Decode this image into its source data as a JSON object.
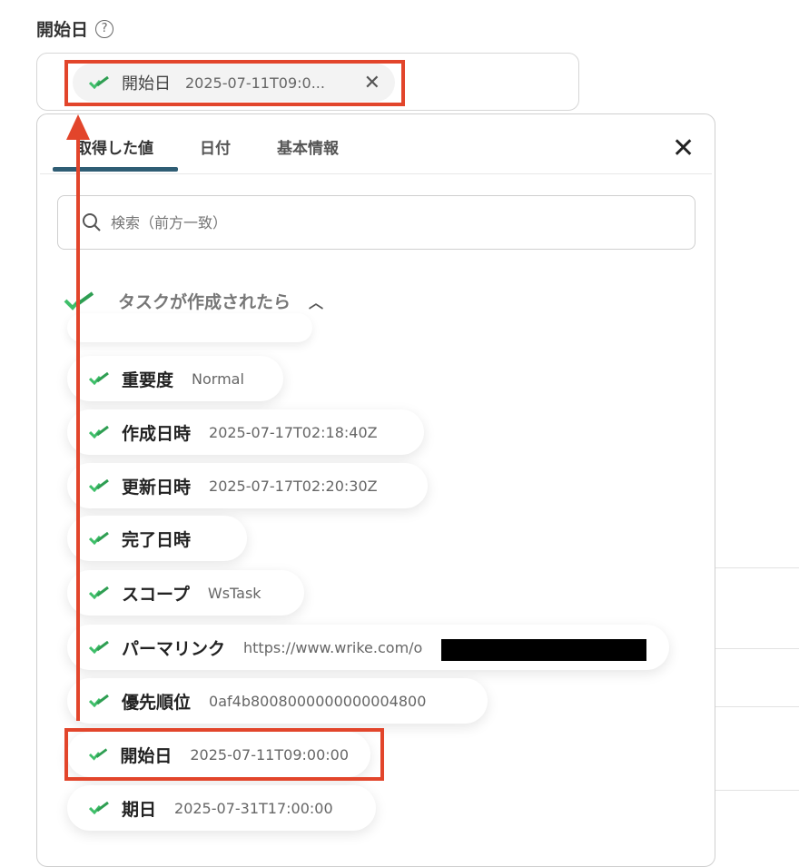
{
  "field": {
    "label": "開始日",
    "help": "?"
  },
  "selected_chip": {
    "label": "開始日",
    "value": "2025-07-11T09:0...",
    "remove": "✕"
  },
  "panel": {
    "tabs": [
      "取得した値",
      "日付",
      "基本情報"
    ],
    "close": "✕",
    "search_placeholder": "検索（前方一致）",
    "group_title": "タスクが作成されたら",
    "group_caret": "︿",
    "items": [
      {
        "label": "重要度",
        "value": "Normal"
      },
      {
        "label": "作成日時",
        "value": "2025-07-17T02:18:40Z"
      },
      {
        "label": "更新日時",
        "value": "2025-07-17T02:20:30Z"
      },
      {
        "label": "完了日時",
        "value": ""
      },
      {
        "label": "スコープ",
        "value": "WsTask"
      },
      {
        "label": "パーマリンク",
        "value": "https://www.wrike.com/o"
      },
      {
        "label": "優先順位",
        "value": "0af4b8008000000000004800"
      },
      {
        "label": "開始日",
        "value": "2025-07-11T09:00:00"
      },
      {
        "label": "期日",
        "value": "2025-07-31T17:00:00"
      }
    ]
  },
  "colors": {
    "accent": "#2f5d74",
    "highlight": "#e2452b",
    "check": "#3fbf6a"
  }
}
